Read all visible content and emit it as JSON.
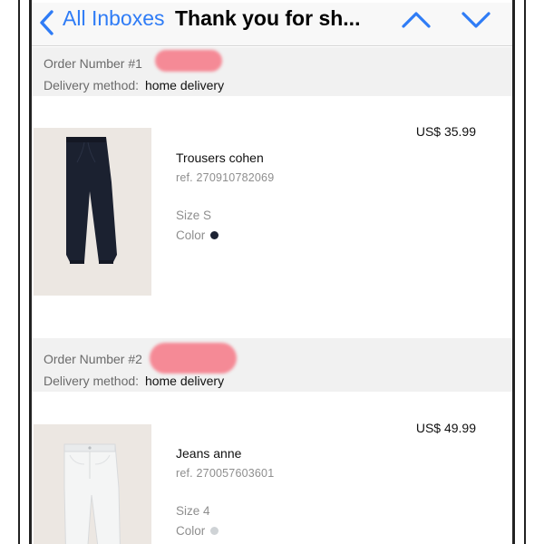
{
  "nav": {
    "back_label": "All Inboxes",
    "title": "Thank you for sh...",
    "accent_color": "#2f7cf6"
  },
  "orders": [
    {
      "order_label": "Order Number #1",
      "delivery_key": "Delivery method:",
      "delivery_value": "home delivery",
      "product": {
        "price": "US$ 35.99",
        "name": "Trousers cohen",
        "ref": "ref. 270910782069",
        "size": "Size S",
        "color_label": "Color",
        "color_hex": "#1c2233"
      }
    },
    {
      "order_label": "Order Number #2",
      "delivery_key": "Delivery method:",
      "delivery_value": "home delivery",
      "product": {
        "price": "US$ 49.99",
        "name": "Jeans anne",
        "ref": "ref. 270057603601",
        "size": "Size 4",
        "color_label": "Color",
        "color_hex": "#cfd3d6"
      }
    }
  ],
  "icons": {
    "back": "chevron-left-icon",
    "previous": "chevron-up-icon",
    "next": "chevron-down-icon"
  }
}
